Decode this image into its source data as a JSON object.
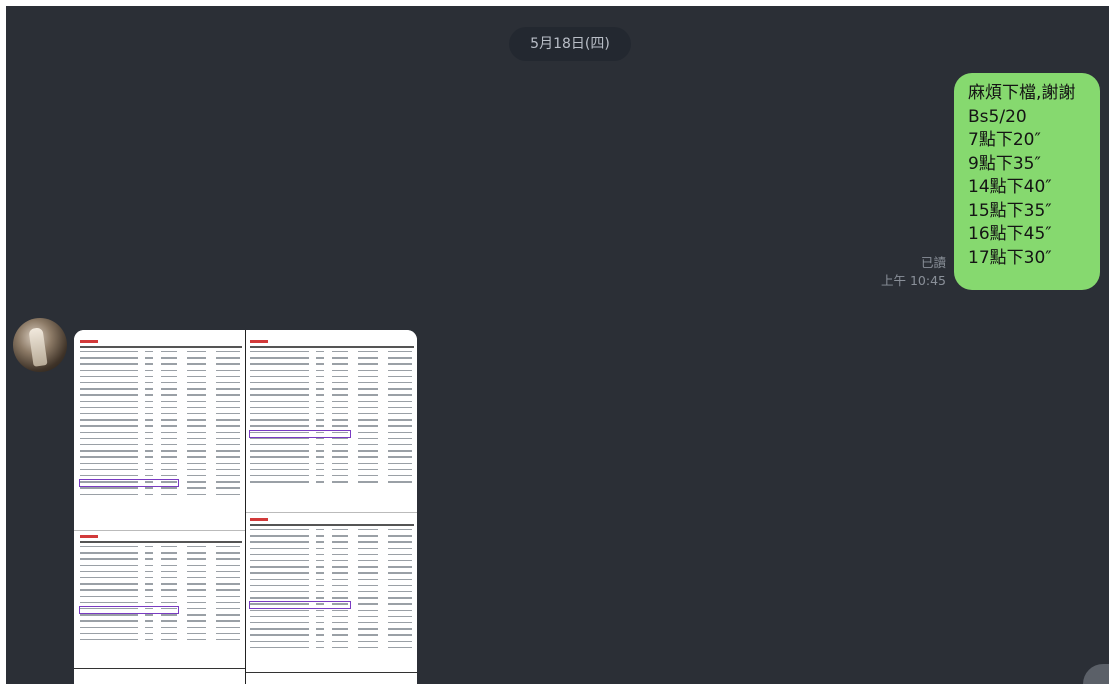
{
  "chat": {
    "date_label": "5月18日(四)",
    "outgoing": {
      "lines": [
        "麻煩下檔,謝謝",
        "Bs5/20",
        "7點下20″",
        "9點下35″",
        "14點下40″",
        "15點下35″",
        "16點下45″",
        "17點下30″"
      ],
      "read_label": "已讀",
      "time": "上午 10:45"
    },
    "incoming": {
      "image_alt": "document-screenshot"
    }
  },
  "colors": {
    "background": "#2b2f36",
    "bubble": "#86d96f",
    "date_pill": "#232830",
    "highlight": "#7a3cc2"
  }
}
